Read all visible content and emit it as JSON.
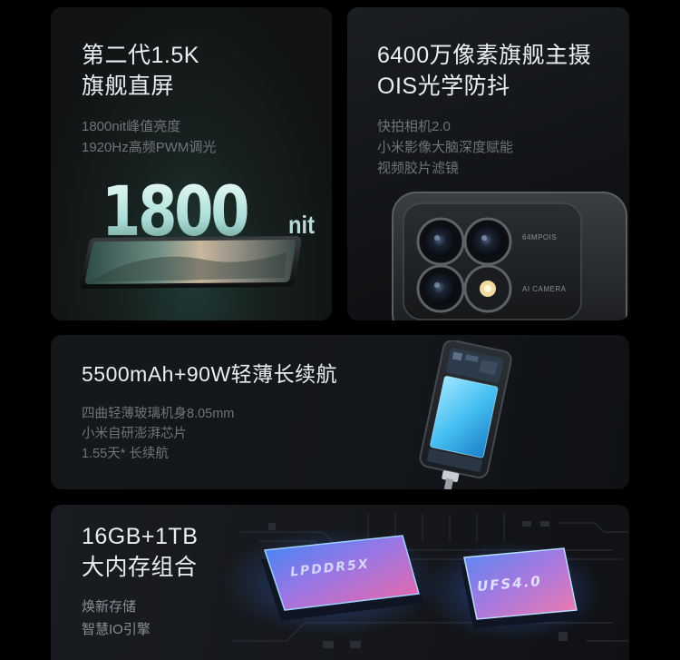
{
  "display": {
    "title_line1": "第二代1.5K",
    "title_line2": "旗舰直屏",
    "desc": [
      "1800nit峰值亮度",
      "1920Hz高频PWM调光"
    ],
    "big_number": "1800",
    "big_unit": "nit"
  },
  "camera": {
    "title_line1": "6400万像素旗舰主摄",
    "title_line2": "OIS光学防抖",
    "desc": [
      "快拍相机2.0",
      "小米影像大脑深度赋能",
      "视频胶片滤镜"
    ],
    "module_label_top": "64MPOIS",
    "module_label_bottom": "AI CAMERA"
  },
  "battery": {
    "title": "5500mAh+90W轻薄长续航",
    "desc": [
      "四曲轻薄玻璃机身8.05mm",
      "小米自研澎湃芯片",
      "1.55天* 长续航"
    ]
  },
  "storage": {
    "title_line1": "16GB+1TB",
    "title_line2": "大内存组合",
    "desc": [
      "焕新存储",
      "智慧IO引擎"
    ],
    "chip1_label": "LPDDR5X",
    "chip2_label": "UFS4.0"
  }
}
